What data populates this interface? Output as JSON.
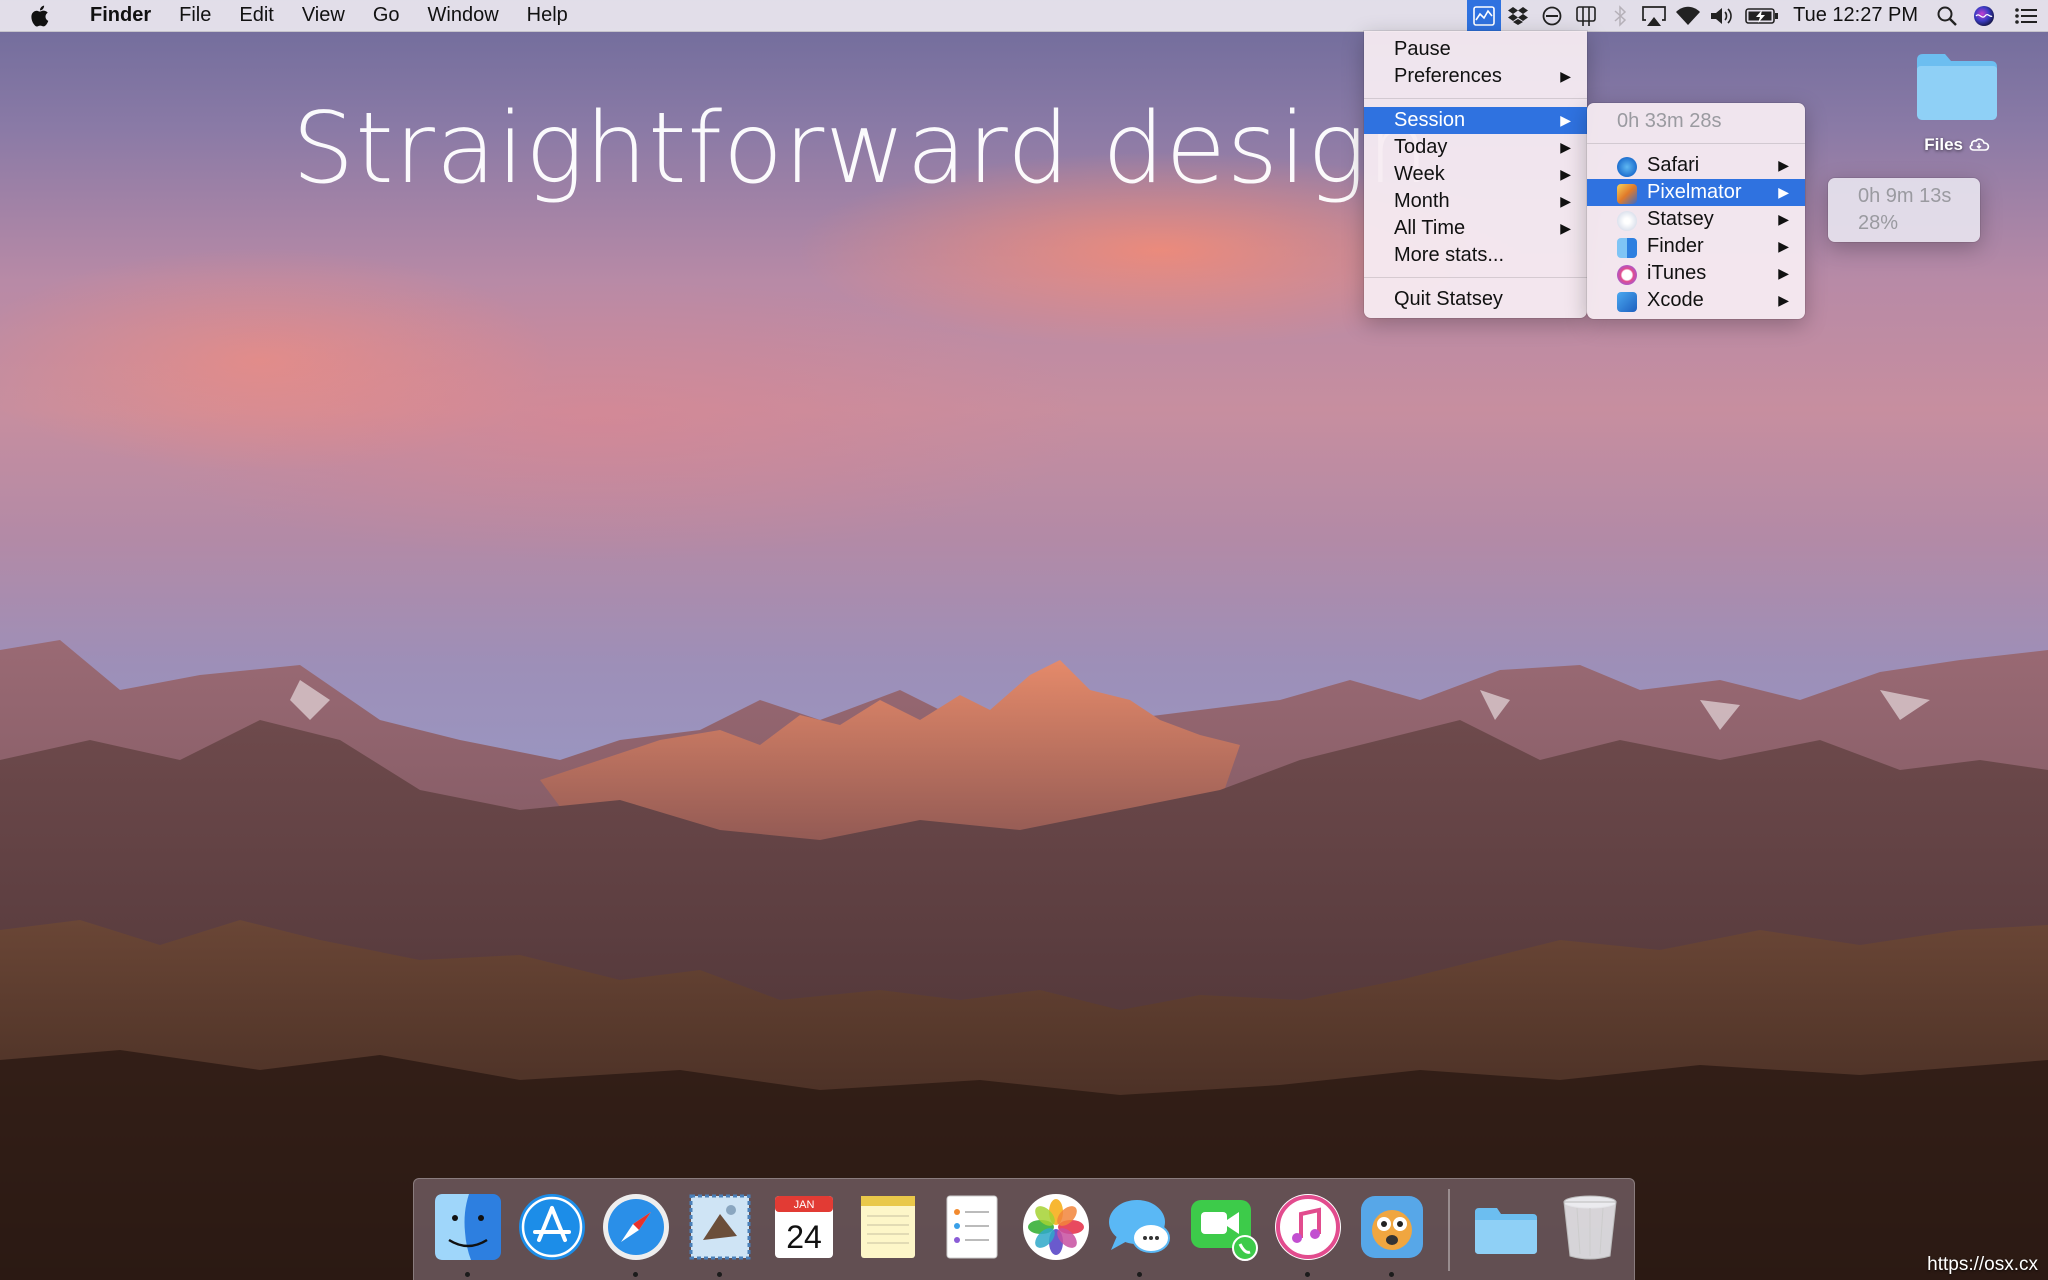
{
  "headline": "Straightforward design",
  "menubar": {
    "app_name": "Finder",
    "menus": [
      "File",
      "Edit",
      "View",
      "Go",
      "Window",
      "Help"
    ],
    "clock": "Tue 12:27 PM",
    "status_icons": [
      "statsey-icon",
      "dropbox-icon",
      "do-not-disturb-icon",
      "cpu-monitor-icon",
      "bluetooth-icon",
      "airplay-icon",
      "wifi-icon",
      "volume-icon",
      "battery-icon",
      "spotlight-icon",
      "siri-icon",
      "notification-center-icon"
    ]
  },
  "statsey_menu": {
    "pause": "Pause",
    "preferences": "Preferences",
    "session": "Session",
    "today": "Today",
    "week": "Week",
    "month": "Month",
    "all_time": "All Time",
    "more_stats": "More stats...",
    "quit": "Quit Statsey"
  },
  "session_menu": {
    "total": "0h 33m 28s",
    "apps": [
      {
        "name": "Safari",
        "icon": "safari-icon"
      },
      {
        "name": "Pixelmator",
        "icon": "pixelmator-icon"
      },
      {
        "name": "Statsey",
        "icon": "statsey-icon"
      },
      {
        "name": "Finder",
        "icon": "finder-icon"
      },
      {
        "name": "iTunes",
        "icon": "itunes-icon"
      },
      {
        "name": "Xcode",
        "icon": "xcode-icon"
      }
    ],
    "highlighted_app": "Pixelmator"
  },
  "pixelmator_menu": {
    "time": "0h 9m 13s",
    "percent": "28%"
  },
  "desktop": {
    "folder_label": "Files"
  },
  "dock": {
    "apps": [
      {
        "name": "Finder",
        "icon": "finder-icon",
        "running": true
      },
      {
        "name": "App Store",
        "icon": "app-store-icon",
        "running": false
      },
      {
        "name": "Safari",
        "icon": "safari-icon",
        "running": true
      },
      {
        "name": "Mail",
        "icon": "mail-icon",
        "running": true
      },
      {
        "name": "Calendar",
        "icon": "calendar-icon",
        "running": false,
        "month": "JAN",
        "day": "24"
      },
      {
        "name": "Notes",
        "icon": "notes-icon",
        "running": false
      },
      {
        "name": "Reminders",
        "icon": "reminders-icon",
        "running": false
      },
      {
        "name": "Photos",
        "icon": "photos-icon",
        "running": false
      },
      {
        "name": "Messages",
        "icon": "messages-icon",
        "running": true
      },
      {
        "name": "FaceTime",
        "icon": "facetime-icon",
        "running": false
      },
      {
        "name": "iTunes",
        "icon": "itunes-icon",
        "running": true
      },
      {
        "name": "Tweetbot",
        "icon": "tweetbot-icon",
        "running": true
      }
    ],
    "stacks": [
      {
        "name": "Files",
        "icon": "folder-icon"
      },
      {
        "name": "Trash",
        "icon": "trash-icon"
      }
    ]
  },
  "watermark": "https://osx.cx",
  "colors": {
    "menu_highlight": "#2f72e0",
    "menu_background": "#f6ecf2"
  }
}
